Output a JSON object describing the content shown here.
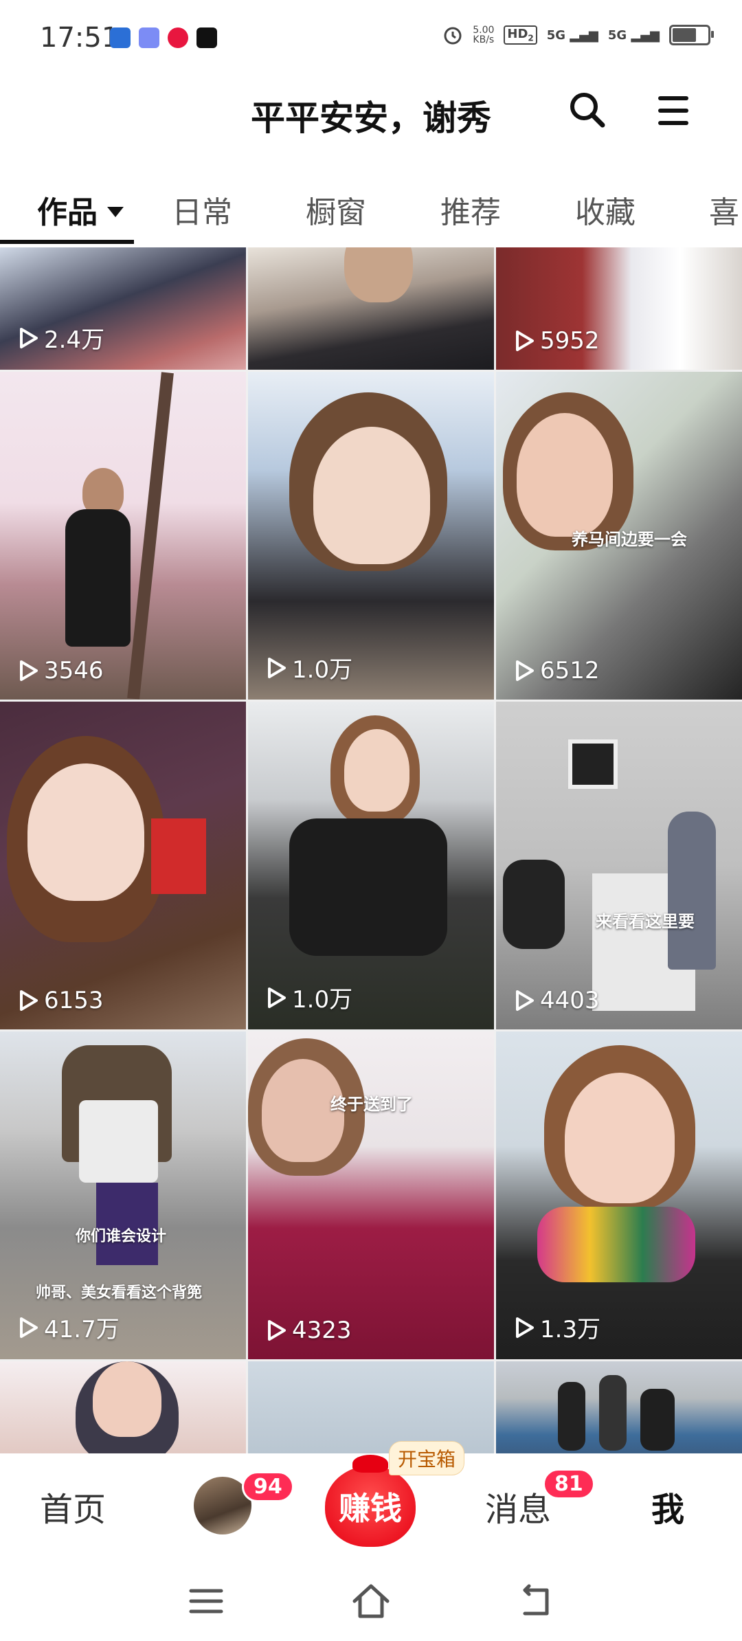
{
  "status_bar": {
    "time": "17:51",
    "net_speed_value": "5.00",
    "net_speed_unit": "KB/s",
    "hd": "HD",
    "hd_sub": "2",
    "signal_1": "5G",
    "signal_2": "5G",
    "app_icons": [
      "shield-app-icon",
      "baby-app-icon",
      "play-app-icon",
      "tiktok-app-icon"
    ]
  },
  "header": {
    "title": "平平安安，谢秀",
    "search_icon": "search-icon",
    "menu_icon": "menu-icon"
  },
  "tabs": [
    {
      "label": "作品",
      "active": true
    },
    {
      "label": "日常",
      "active": false
    },
    {
      "label": "橱窗",
      "active": false
    },
    {
      "label": "推荐",
      "active": false
    },
    {
      "label": "收藏",
      "active": false
    },
    {
      "label": "喜",
      "active": false
    }
  ],
  "videos": [
    {
      "plays": "2.4万"
    },
    {
      "plays": ""
    },
    {
      "plays": "5952"
    },
    {
      "plays": "3546"
    },
    {
      "plays": "1.0万"
    },
    {
      "plays": "6512",
      "caption": "养马间边要一会"
    },
    {
      "plays": "6153"
    },
    {
      "plays": "1.0万"
    },
    {
      "plays": "4403",
      "caption": "来看看这里要"
    },
    {
      "plays": "41.7万",
      "caption": "帅哥、美女看看这个背篼",
      "caption2": "你们谁会设计"
    },
    {
      "plays": "4323",
      "caption": "终于送到了"
    },
    {
      "plays": "1.3万"
    },
    {
      "plays": ""
    },
    {
      "plays": ""
    },
    {
      "plays": ""
    }
  ],
  "bottom_nav": {
    "home": "首页",
    "friends_badge": "94",
    "earn": "赚钱",
    "treasure": "开宝箱",
    "messages": "消息",
    "messages_badge": "81",
    "me": "我"
  },
  "colors": {
    "accent_red": "#fe2c55",
    "earn_red": "#e60012"
  }
}
